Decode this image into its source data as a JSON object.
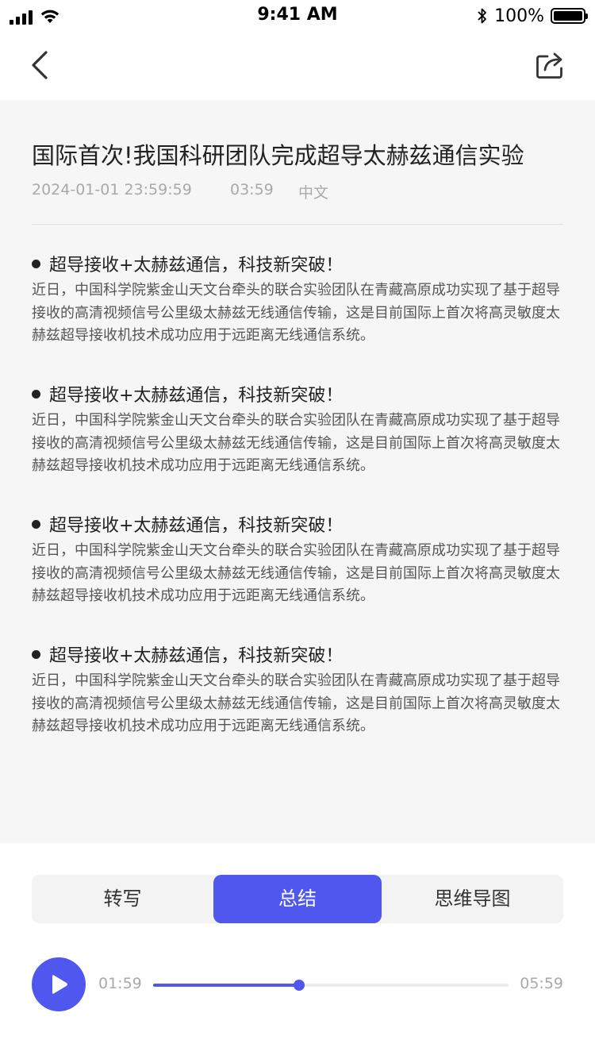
{
  "status_bar": {
    "time": "9:41 AM",
    "battery": "100%"
  },
  "nav": {
    "back_icon": "chevron-left-icon",
    "share_icon": "share-icon"
  },
  "article": {
    "title": "国际首次!我国科研团队完成超导太赫兹通信实验",
    "date": "2024-01-01 23:59:59",
    "duration": "03:59",
    "language": "中文"
  },
  "sections": [
    {
      "heading": "超导接收+太赫兹通信，科技新突破！",
      "body": "近日，中国科学院紫金山天文台牵头的联合实验团队在青藏高原成功实现了基于超导接收的高清视频信号公里级太赫兹无线通信传输，这是目前国际上首次将高灵敏度太赫兹超导接收机技术成功应用于远距离无线通信系统。"
    },
    {
      "heading": "超导接收+太赫兹通信，科技新突破！",
      "body": "近日，中国科学院紫金山天文台牵头的联合实验团队在青藏高原成功实现了基于超导接收的高清视频信号公里级太赫兹无线通信传输，这是目前国际上首次将高灵敏度太赫兹超导接收机技术成功应用于远距离无线通信系统。"
    },
    {
      "heading": "超导接收+太赫兹通信，科技新突破！",
      "body": "近日，中国科学院紫金山天文台牵头的联合实验团队在青藏高原成功实现了基于超导接收的高清视频信号公里级太赫兹无线通信传输，这是目前国际上首次将高灵敏度太赫兹超导接收机技术成功应用于远距离无线通信系统。"
    },
    {
      "heading": "超导接收+太赫兹通信，科技新突破！",
      "body": "近日，中国科学院紫金山天文台牵头的联合实验团队在青藏高原成功实现了基于超导接收的高清视频信号公里级太赫兹无线通信传输，这是目前国际上首次将高灵敏度太赫兹超导接收机技术成功应用于远距离无线通信系统。"
    }
  ],
  "tabs": [
    {
      "label": "转写",
      "active": false
    },
    {
      "label": "总结",
      "active": true
    },
    {
      "label": "思维导图",
      "active": false
    }
  ],
  "player": {
    "current_time": "01:59",
    "total_time": "05:59",
    "progress": 0.41,
    "play_icon": "play-icon"
  },
  "colors": {
    "accent": "#5057ef",
    "content_background": "#f6f6f6",
    "muted_text": "#a9a9a9"
  }
}
